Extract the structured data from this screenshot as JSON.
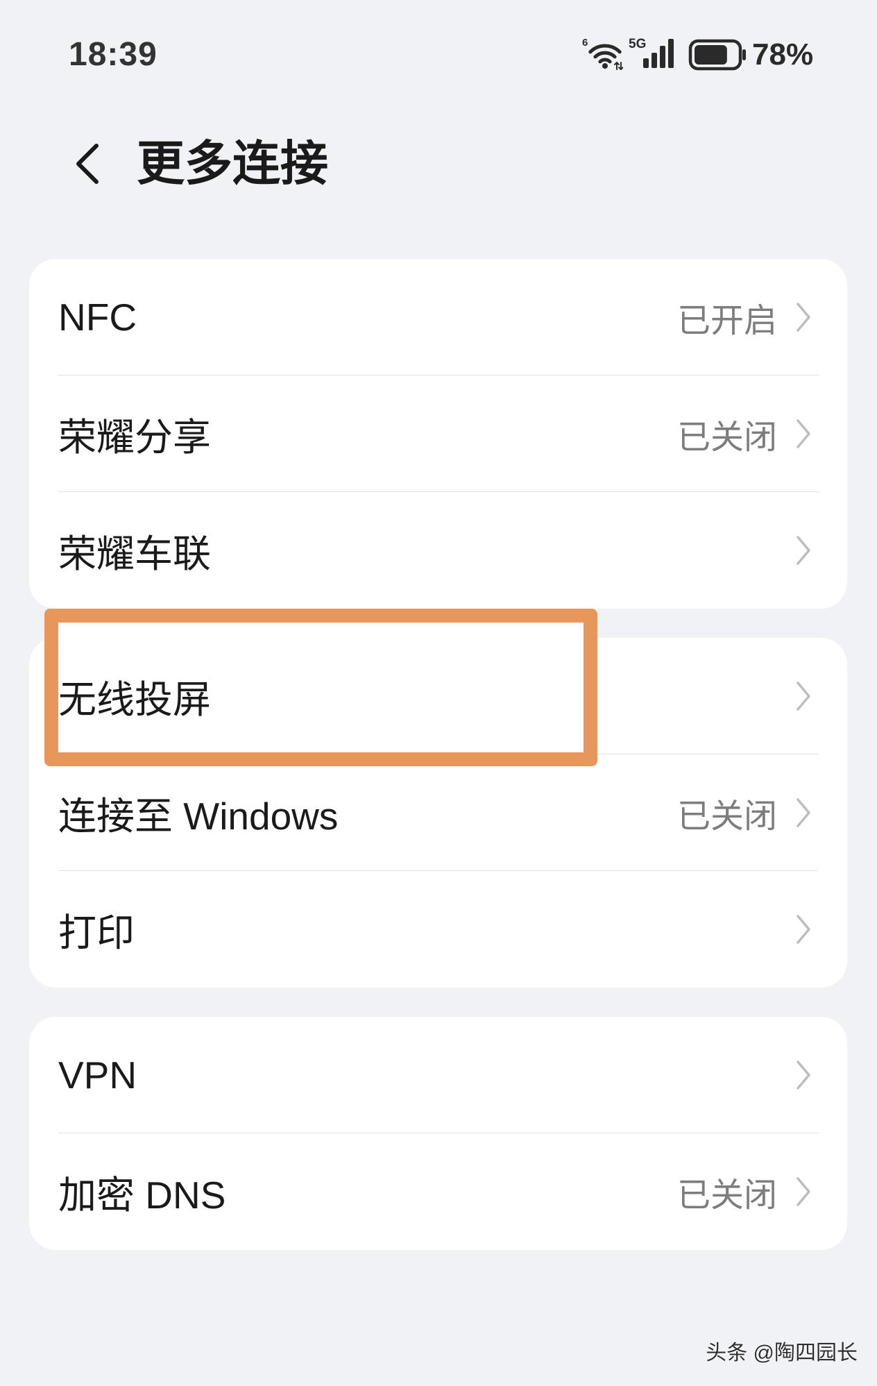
{
  "status_bar": {
    "time": "18:39",
    "wifi_badge": "6",
    "network_type": "5G",
    "signal_bars": 4,
    "battery_percent": "78%",
    "icons": [
      "wifi-icon",
      "cellular-signal-icon",
      "battery-icon"
    ]
  },
  "header": {
    "title": "更多连接",
    "back_icon": "chevron-left-icon"
  },
  "groups": [
    {
      "rows": [
        {
          "label": "NFC",
          "value": "已开启"
        },
        {
          "label": "荣耀分享",
          "value": "已关闭"
        },
        {
          "label": "荣耀车联"
        }
      ]
    },
    {
      "rows": [
        {
          "label": "无线投屏",
          "highlighted": true
        },
        {
          "label": "连接至 Windows",
          "value": "已关闭"
        },
        {
          "label": "打印"
        }
      ]
    },
    {
      "rows": [
        {
          "label": "VPN"
        },
        {
          "label": "加密 DNS",
          "value": "已关闭"
        }
      ]
    }
  ],
  "row_trailing_icon": "chevron-right-icon",
  "watermark": "头条 @陶四园长",
  "colors": {
    "background": "#F1F2F6",
    "card": "#FFFFFF",
    "highlight_border": "#E8975C",
    "text_primary": "#1A1A1A",
    "text_secondary": "#7D7D7D",
    "chevron": "#BDBDBD"
  }
}
